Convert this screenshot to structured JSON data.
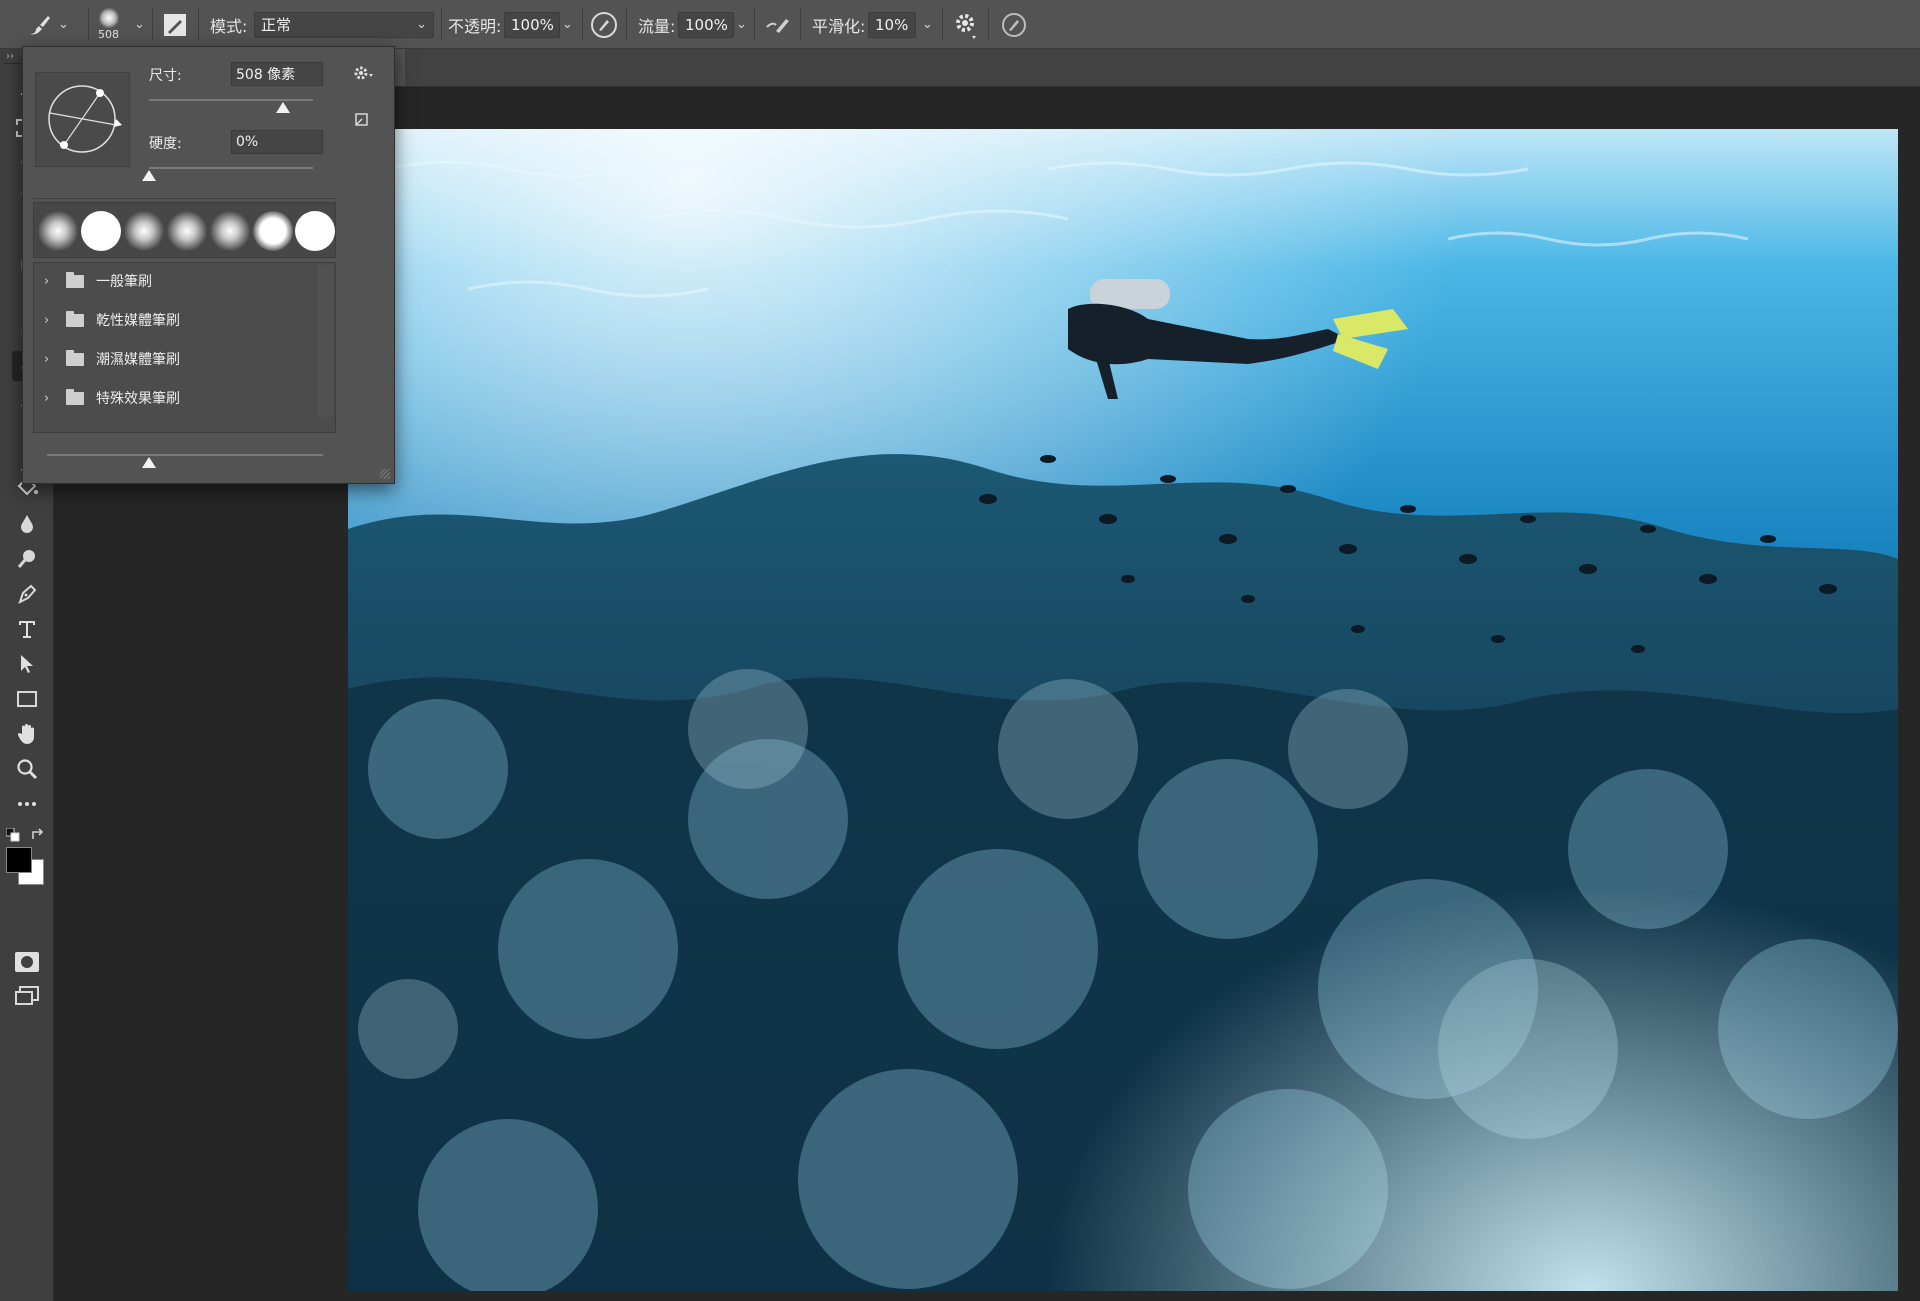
{
  "options_bar": {
    "brush_size_value": "508",
    "mode_label": "模式:",
    "mode_value": "正常",
    "opacity_label": "不透明:",
    "opacity_value": "100%",
    "flow_label": "流量:",
    "flow_value": "100%",
    "smoothing_label": "平滑化:",
    "smoothing_value": "10%"
  },
  "brush_popup": {
    "size_label": "尺寸:",
    "size_value": "508 像素",
    "size_level": 0.82,
    "hardness_label": "硬度:",
    "hardness_value": "0%",
    "hardness_level": 0.0,
    "preview_size_level": 0.37,
    "folders": [
      {
        "label": "一般筆刷"
      },
      {
        "label": "乾性媒體筆刷"
      },
      {
        "label": "潮濕媒體筆刷"
      },
      {
        "label": "特殊效果筆刷"
      }
    ]
  },
  "colors": {
    "foreground": "#000000",
    "background": "#ffffff",
    "ui_panel": "#535353",
    "ui_dark": "#262626"
  },
  "tools": [
    "move-tool",
    "marquee-tool",
    "lasso-tool",
    "quick-select-tool",
    "crop-tool",
    "frame-tool",
    "eyedropper-tool",
    "healing-tool",
    "brush-tool",
    "clone-stamp-tool",
    "history-brush-tool",
    "eraser-tool",
    "gradient-tool",
    "blur-tool",
    "dodge-tool",
    "pen-tool",
    "type-tool",
    "path-select-tool",
    "rectangle-tool",
    "hand-tool",
    "zoom-tool",
    "more-tools"
  ]
}
